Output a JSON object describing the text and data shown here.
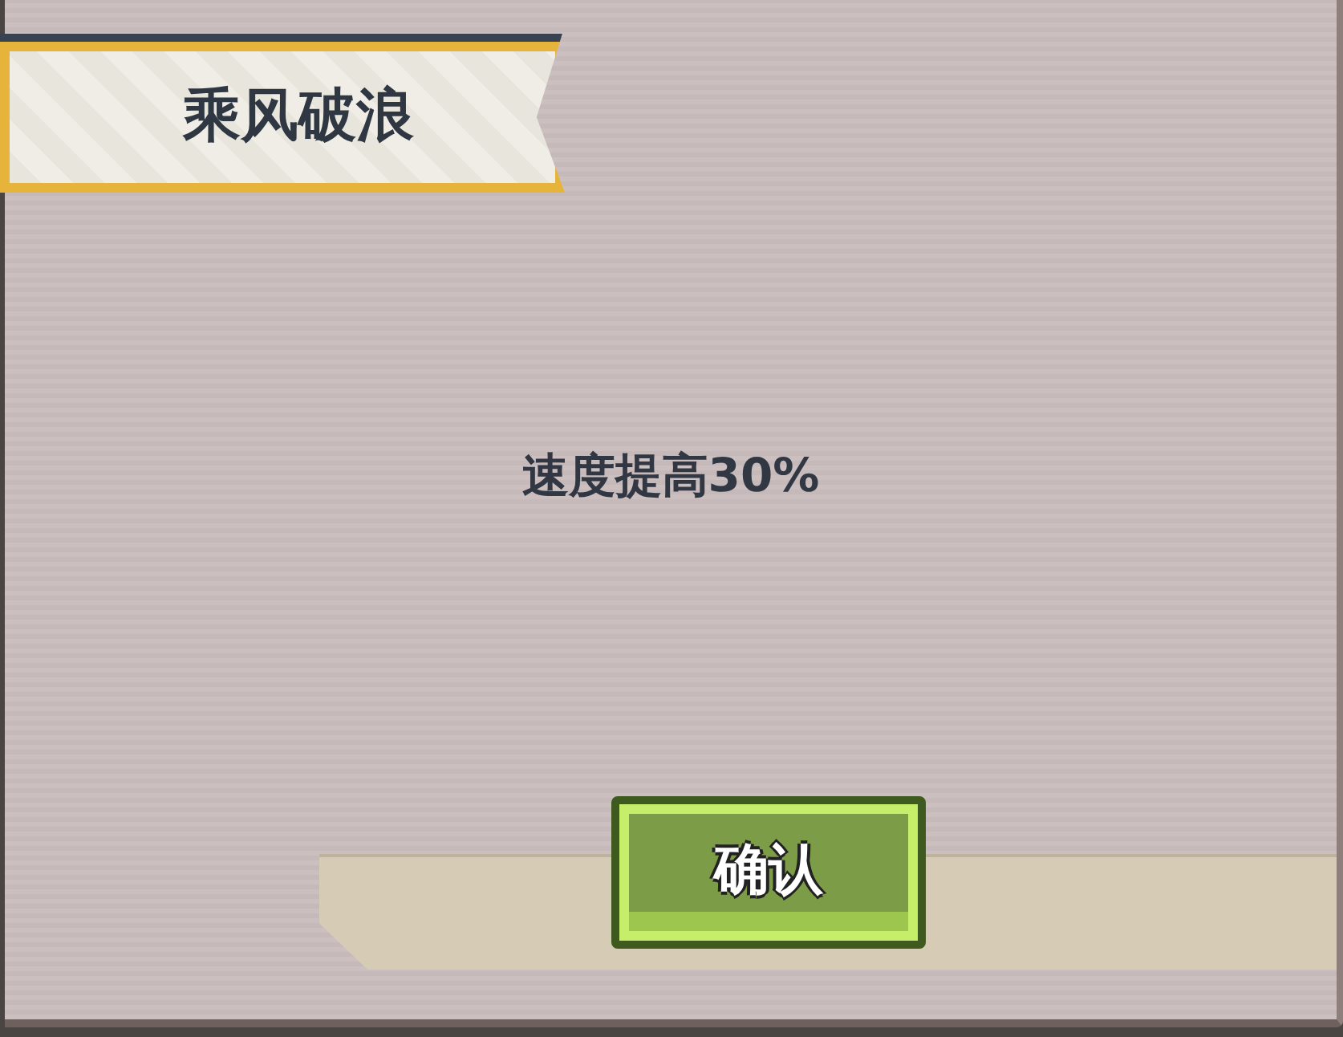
{
  "dialog": {
    "title": "乘风破浪",
    "message": "速度提高30%",
    "buttons": [
      {
        "label": "确认"
      }
    ]
  }
}
